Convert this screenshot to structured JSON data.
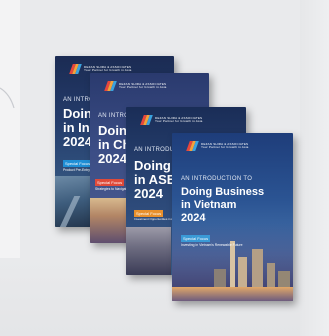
{
  "brand": {
    "logo_line1": "DEZAN SHIRA & ASSOCIATES",
    "logo_line2": "Your Partner for Growth in Asia",
    "logo_colors": [
      "#e8463c",
      "#f2a23a",
      "#3aa3df"
    ]
  },
  "booklets": [
    {
      "id": "india",
      "intro": "AN INTRODUCTION TO",
      "title_line1": "Doing Business",
      "title_line2": "in India",
      "year": "2024",
      "focus_label": "Special Focus",
      "focus_text": "Product Pre-Entry Business Planning 2024 Edition",
      "focus_color": "#1f8fd6"
    },
    {
      "id": "china",
      "intro": "AN INTRODUCTION TO",
      "title_line1": "Doing Business",
      "title_line2": "in China",
      "year": "2024",
      "focus_label": "Special Focus",
      "focus_text": "Strategies to Navigate Changing Market",
      "focus_color": "#e04a3a"
    },
    {
      "id": "asean",
      "intro": "AN INTRODUCTION TO",
      "title_line1": "Doing Business",
      "title_line2": "in ASEAN",
      "year": "2024",
      "focus_label": "Special Focus",
      "focus_text": "Investment Opportunities in ASEAN's Renewable Energy Industry",
      "focus_color": "#e8902c"
    },
    {
      "id": "vietnam",
      "intro": "AN INTRODUCTION TO",
      "title_line1": "Doing Business",
      "title_line2": "in Vietnam",
      "year": "2024",
      "focus_label": "Special Focus",
      "focus_text": "Investing in Vietnam's Renewable Future",
      "focus_color": "#3a9ad6"
    }
  ]
}
